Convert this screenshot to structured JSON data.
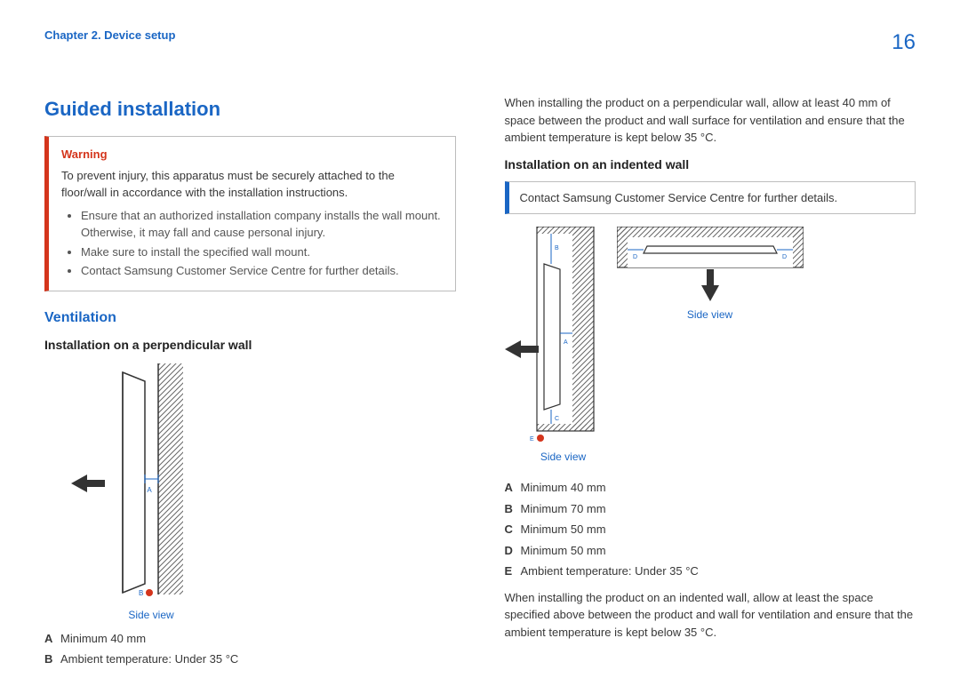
{
  "header": {
    "chapter": "Chapter 2. Device setup",
    "page_number": "16"
  },
  "section_title": "Guided installation",
  "warning": {
    "title": "Warning",
    "body": "To prevent injury, this apparatus must be securely attached to the floor/wall in accordance with the installation instructions.",
    "bullets": [
      "Ensure that an authorized installation company installs the wall mount. Otherwise, it may fall and cause personal injury.",
      "Make sure to install the specified wall mount.",
      "Contact Samsung Customer Service Centre for further details."
    ]
  },
  "ventilation": {
    "title": "Ventilation",
    "perpendicular": {
      "title": "Installation on a perpendicular wall",
      "side_view_label": "Side view",
      "legend": {
        "A": "Minimum 40 mm",
        "B": "Ambient temperature: Under 35 °C"
      },
      "paragraph": "When installing the product on a perpendicular wall, allow at least 40 mm of space between the product and wall surface for ventilation and ensure that the ambient temperature is kept below 35 °C."
    },
    "indented": {
      "title": "Installation on an indented wall",
      "info_note": "Contact Samsung Customer Service Centre for further details.",
      "side_view_label_1": "Side view",
      "side_view_label_2": "Side view",
      "legend": {
        "A": "Minimum 40 mm",
        "B": "Minimum 70 mm",
        "C": "Minimum 50 mm",
        "D": "Minimum 50 mm",
        "E": "Ambient temperature: Under 35 °C"
      },
      "paragraph": "When installing the product on an indented wall, allow at least the space specified above between the product and wall for ventilation and ensure that the ambient temperature is kept below 35 °C."
    }
  },
  "diagram_labels": {
    "A": "A",
    "B": "B",
    "C": "C",
    "D": "D",
    "E": "E"
  }
}
